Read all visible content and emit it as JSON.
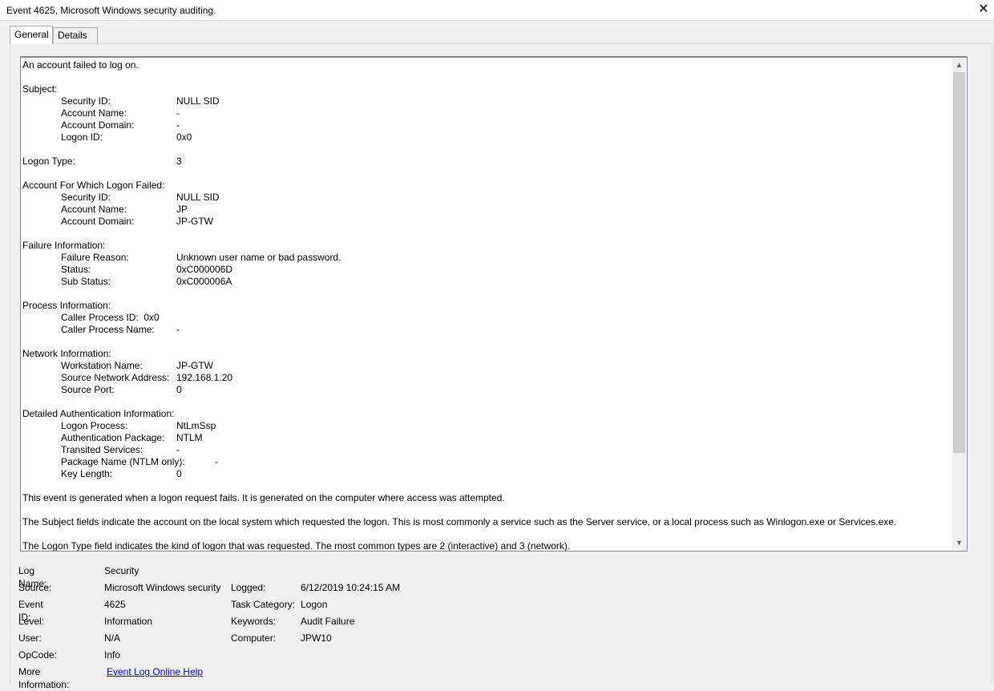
{
  "window": {
    "title": "Event 4625, Microsoft Windows security auditing.",
    "close_glyph": "✕"
  },
  "tabs": [
    {
      "label": "General",
      "active": true
    },
    {
      "label": "Details",
      "active": false
    }
  ],
  "description": {
    "intro": "An account failed to log on.",
    "subject": {
      "heading": "Subject:",
      "security_id_label": "Security ID:",
      "security_id": "NULL SID",
      "account_name_label": "Account Name:",
      "account_name": "-",
      "account_domain_label": "Account Domain:",
      "account_domain": "-",
      "logon_id_label": "Logon ID:",
      "logon_id": "0x0"
    },
    "logon_type_label": "Logon Type:",
    "logon_type": "3",
    "failed_account": {
      "heading": "Account For Which Logon Failed:",
      "security_id_label": "Security ID:",
      "security_id": "NULL SID",
      "account_name_label": "Account Name:",
      "account_name": "JP",
      "account_domain_label": "Account Domain:",
      "account_domain": "JP-GTW"
    },
    "failure": {
      "heading": "Failure Information:",
      "reason_label": "Failure Reason:",
      "reason": "Unknown user name or bad password.",
      "status_label": "Status:",
      "status": "0xC000006D",
      "sub_status_label": "Sub Status:",
      "sub_status": "0xC000006A"
    },
    "process": {
      "heading": "Process Information:",
      "caller_pid_label": "Caller Process ID:",
      "caller_pid": "0x0",
      "caller_name_label": "Caller Process Name:",
      "caller_name": "-"
    },
    "network": {
      "heading": "Network Information:",
      "workstation_label": "Workstation Name:",
      "workstation": "JP-GTW",
      "source_address_label": "Source Network Address:",
      "source_address": "192.168.1.20",
      "source_port_label": "Source Port:",
      "source_port": "0"
    },
    "auth": {
      "heading": "Detailed Authentication Information:",
      "logon_process_label": "Logon Process:",
      "logon_process": "NtLmSsp",
      "auth_package_label": "Authentication Package:",
      "auth_package": "NTLM",
      "transited_label": "Transited Services:",
      "transited": "-",
      "package_name_label": "Package Name (NTLM only):",
      "package_name": "-",
      "key_length_label": "Key Length:",
      "key_length": "0"
    },
    "para1": "This event is generated when a logon request fails. It is generated on the computer where access was attempted.",
    "para2": "The Subject fields indicate the account on the local system which requested the logon. This is most commonly a service such as the Server service, or a local process such as Winlogon.exe or Services.exe.",
    "para3": "The Logon Type field indicates the kind of logon that was requested. The most common types are 2 (interactive) and 3 (network)."
  },
  "scrollbar": {
    "up_glyph": "▲",
    "down_glyph": "▼"
  },
  "properties": {
    "log_name_label": "Log Name:",
    "log_name": "Security",
    "source_label": "Source:",
    "source": "Microsoft Windows security",
    "logged_label": "Logged:",
    "logged": "6/12/2019 10:24:15 AM",
    "event_id_label": "Event ID:",
    "event_id": "4625",
    "task_category_label": "Task Category:",
    "task_category": "Logon",
    "level_label": "Level:",
    "level": "Information",
    "keywords_label": "Keywords:",
    "keywords": "Audit Failure",
    "user_label": "User:",
    "user": "N/A",
    "computer_label": "Computer:",
    "computer": "JPW10",
    "opcode_label": "OpCode:",
    "opcode": "Info",
    "more_info_label": "More Information:",
    "more_info_link": "Event Log Online Help"
  }
}
